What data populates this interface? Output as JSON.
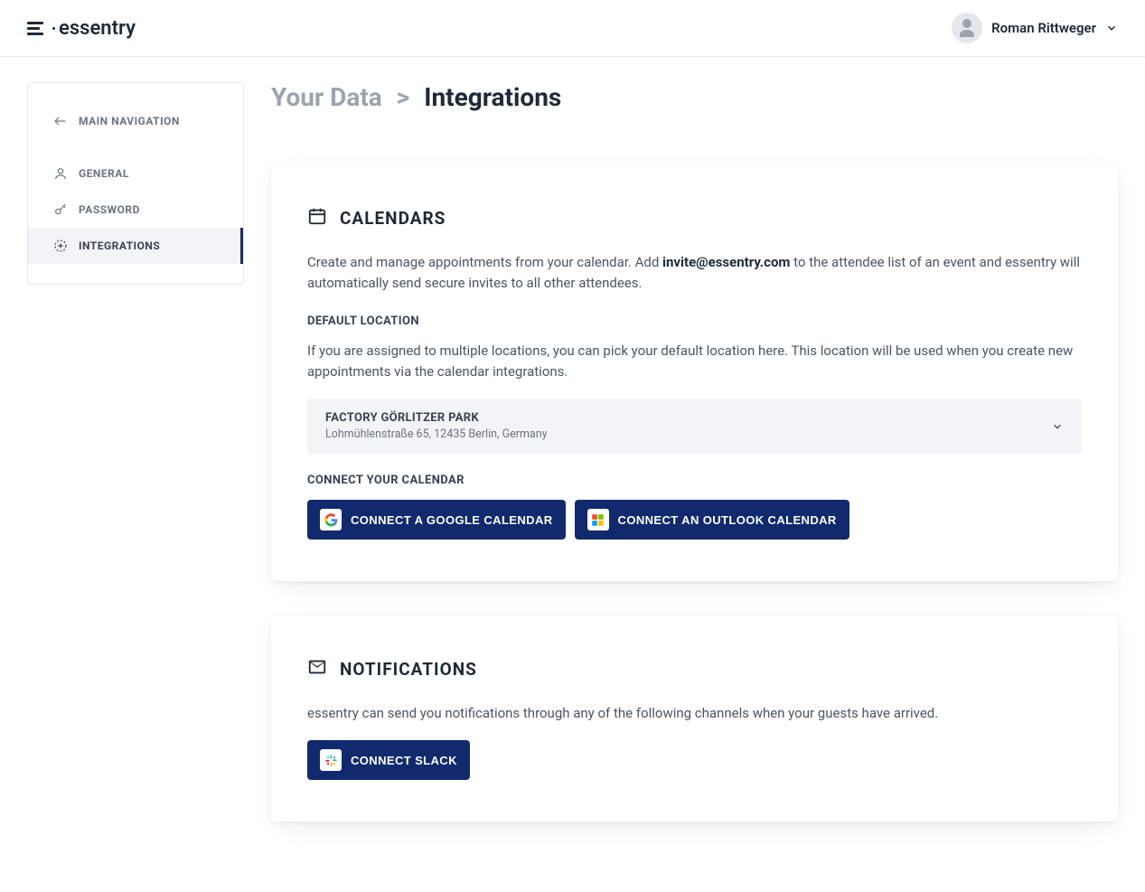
{
  "brand": {
    "name": "essentry"
  },
  "user": {
    "name": "Roman Rittweger"
  },
  "sidebar": {
    "main_nav": "Main Navigation",
    "general": "General",
    "password": "Password",
    "integrations": "Integrations"
  },
  "breadcrumb": {
    "parent": "Your Data",
    "separator": ">",
    "current": "Integrations"
  },
  "calendars": {
    "title": "CALENDARS",
    "description_part1": "Create and manage appointments from your calendar. Add ",
    "description_bold": "invite@essentry.com",
    "description_part2": " to the attendee list of an event and essentry will automatically send secure invites to all other attendees.",
    "default_location_heading": "DEFAULT LOCATION",
    "default_location_help": "If you are assigned to multiple locations, you can pick your default location here. This location will be used when you create new appointments via the calendar integrations.",
    "location": {
      "name": "FACTORY GÖRLITZER PARK",
      "address": "Lohmühlenstraße 65, 12435 Berlin, Germany"
    },
    "connect_heading": "CONNECT YOUR CALENDAR",
    "connect_google": "CONNECT A GOOGLE CALENDAR",
    "connect_outlook": "CONNECT AN OUTLOOK CALENDAR"
  },
  "notifications": {
    "title": "NOTIFICATIONS",
    "description": "essentry can send you notifications through any of the following channels when your guests have arrived.",
    "connect_slack": "CONNECT SLACK"
  }
}
